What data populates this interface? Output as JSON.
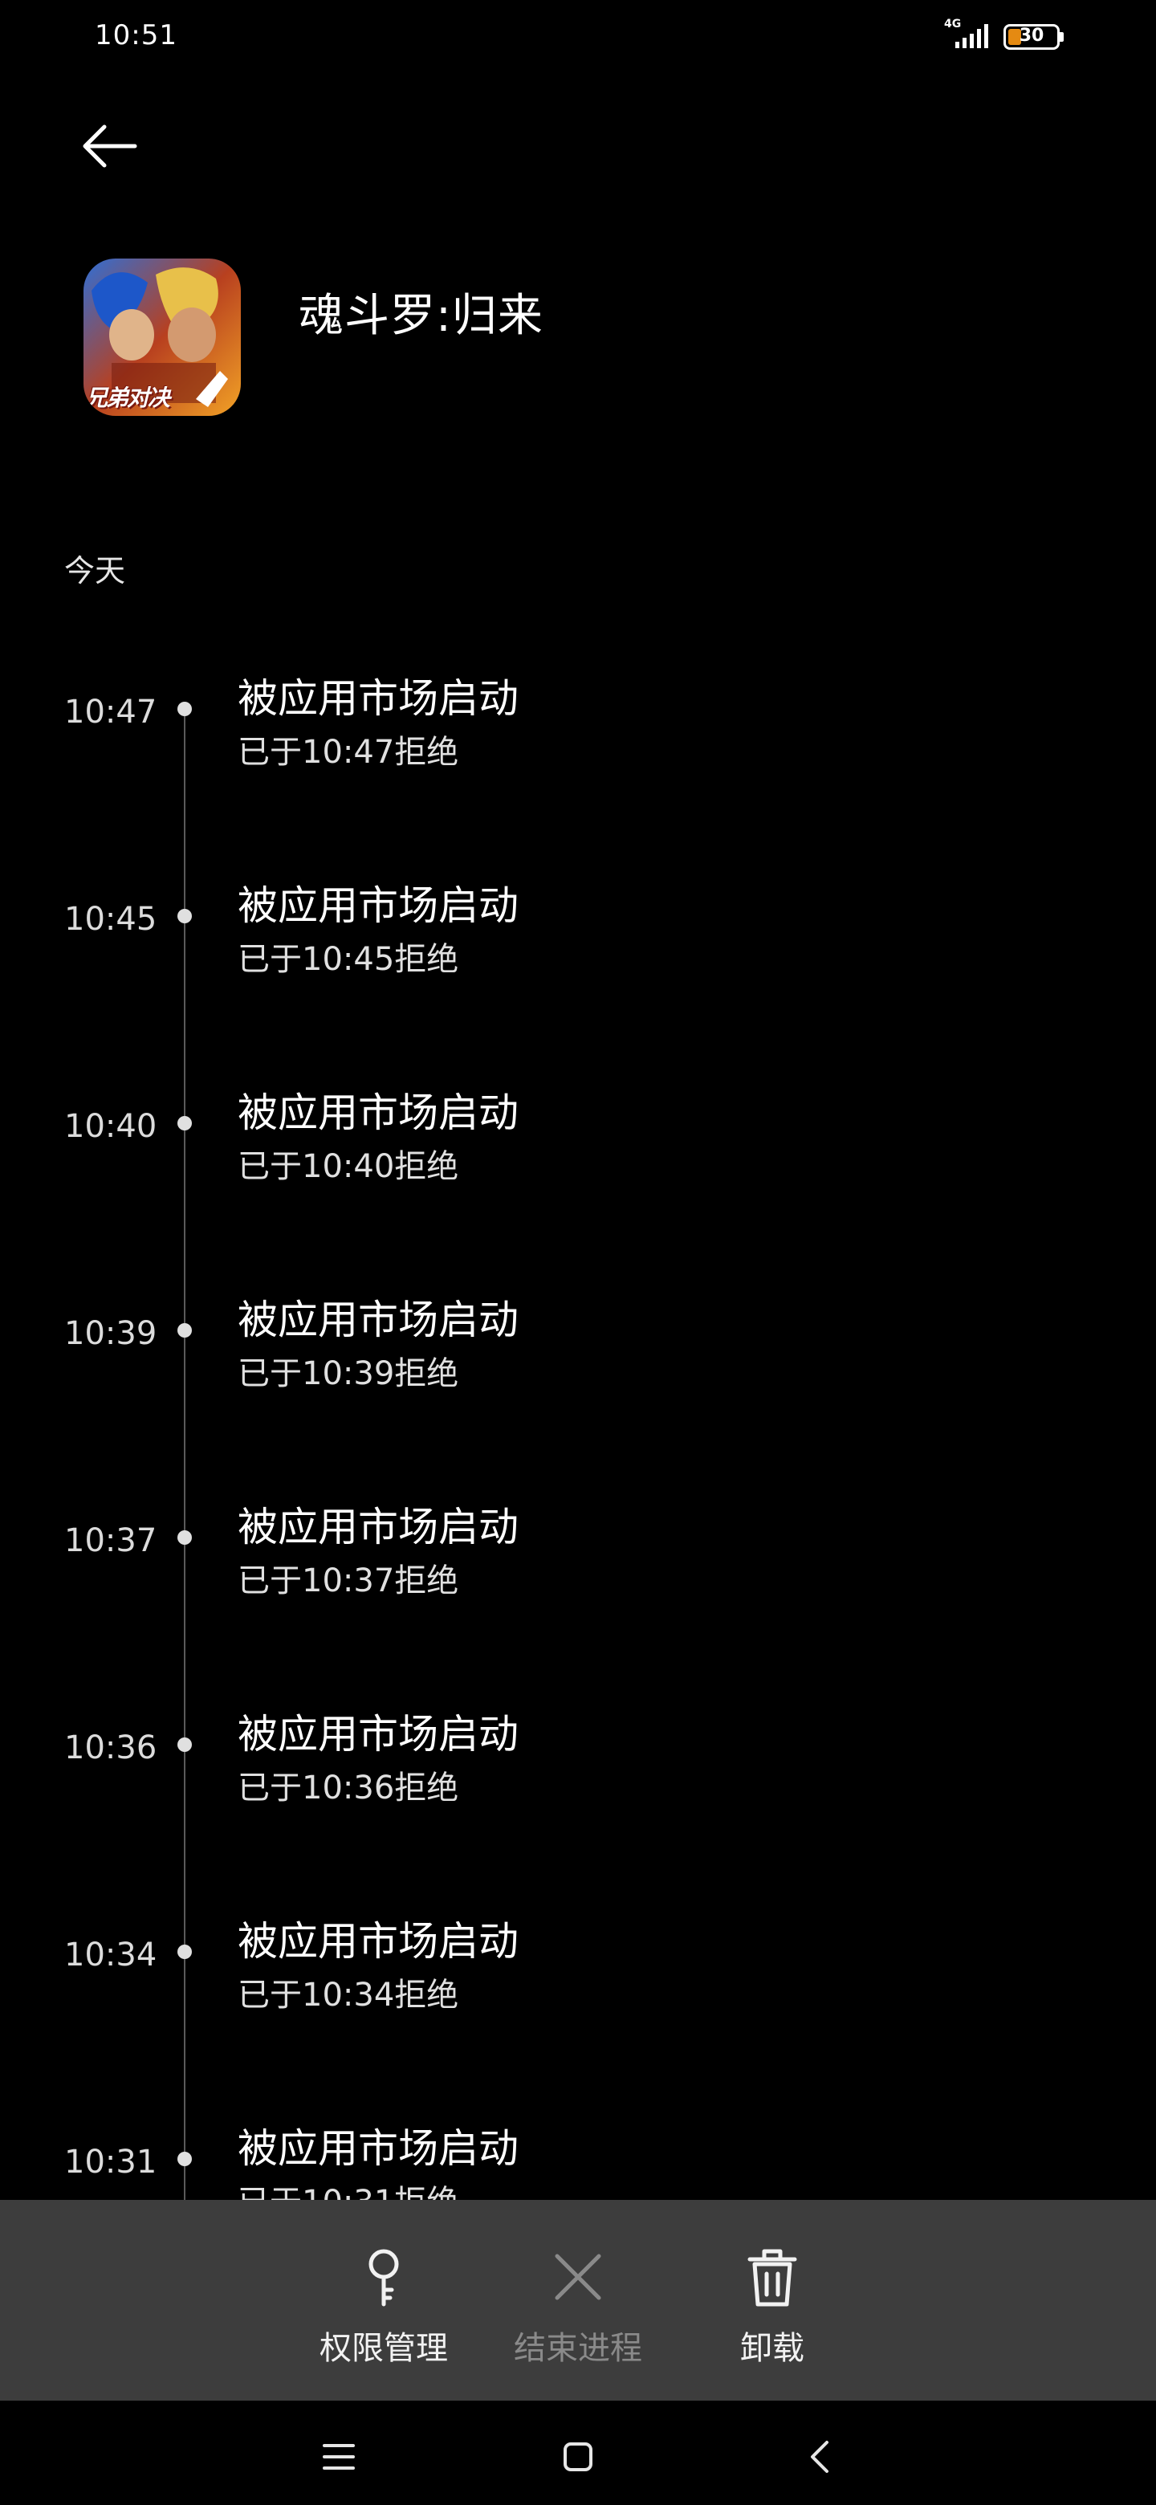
{
  "status_bar": {
    "time": "10:51",
    "network": "4G",
    "battery": "30",
    "battery_color": "#e58a12"
  },
  "header": {
    "back_icon": "back-arrow-icon",
    "app_name": "魂斗罗:归来",
    "app_icon_badge": "兄弟对决"
  },
  "section": {
    "label": "今天"
  },
  "events": [
    {
      "time": "10:47",
      "title": "被应用市场启动",
      "detail": "已于10:47拒绝"
    },
    {
      "time": "10:45",
      "title": "被应用市场启动",
      "detail": "已于10:45拒绝"
    },
    {
      "time": "10:40",
      "title": "被应用市场启动",
      "detail": "已于10:40拒绝"
    },
    {
      "time": "10:39",
      "title": "被应用市场启动",
      "detail": "已于10:39拒绝"
    },
    {
      "time": "10:37",
      "title": "被应用市场启动",
      "detail": "已于10:37拒绝"
    },
    {
      "time": "10:36",
      "title": "被应用市场启动",
      "detail": "已于10:36拒绝"
    },
    {
      "time": "10:34",
      "title": "被应用市场启动",
      "detail": "已于10:34拒绝"
    },
    {
      "time": "10:31",
      "title": "被应用市场启动",
      "detail": "已于10:31拒绝"
    }
  ],
  "actions": [
    {
      "label": "权限管理",
      "icon": "key-icon",
      "enabled": true
    },
    {
      "label": "结束进程",
      "icon": "close-icon",
      "enabled": false
    },
    {
      "label": "卸载",
      "icon": "trash-icon",
      "enabled": true
    }
  ],
  "nav": {
    "menu_icon": "menu-icon",
    "home_icon": "home-square-icon",
    "back_icon": "back-chevron-icon"
  }
}
